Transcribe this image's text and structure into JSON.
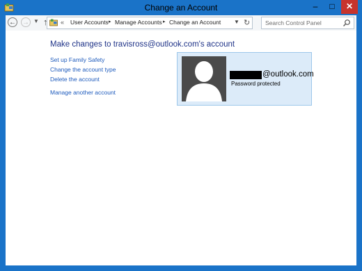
{
  "window": {
    "title": "Change an Account",
    "controls": {
      "minimize": "–",
      "maximize": "□",
      "close": "✕"
    }
  },
  "nav": {
    "back_icon": "back-arrow-icon",
    "forward_icon": "forward-arrow-icon",
    "up_icon": "up-arrow-icon"
  },
  "address_bar": {
    "overflow": "«",
    "breadcrumbs": [
      "User Accounts",
      "Manage Accounts",
      "Change an Account"
    ],
    "separator": "▸"
  },
  "search": {
    "placeholder": "Search Control Panel"
  },
  "main": {
    "title": "Make changes to travisross@outlook.com's account",
    "tasks": [
      "Set up Family Safety",
      "Change the account type",
      "Delete the account",
      "Manage another account"
    ]
  },
  "account_card": {
    "email_visible": "@outlook.com",
    "status": "Password protected"
  },
  "colors": {
    "frame": "#1a73c8",
    "close_button": "#c7342d",
    "title_text": "#1e3287",
    "link_text": "#1e5bbd",
    "card_bg": "#dcebf9",
    "card_border": "#9cc7ea"
  }
}
